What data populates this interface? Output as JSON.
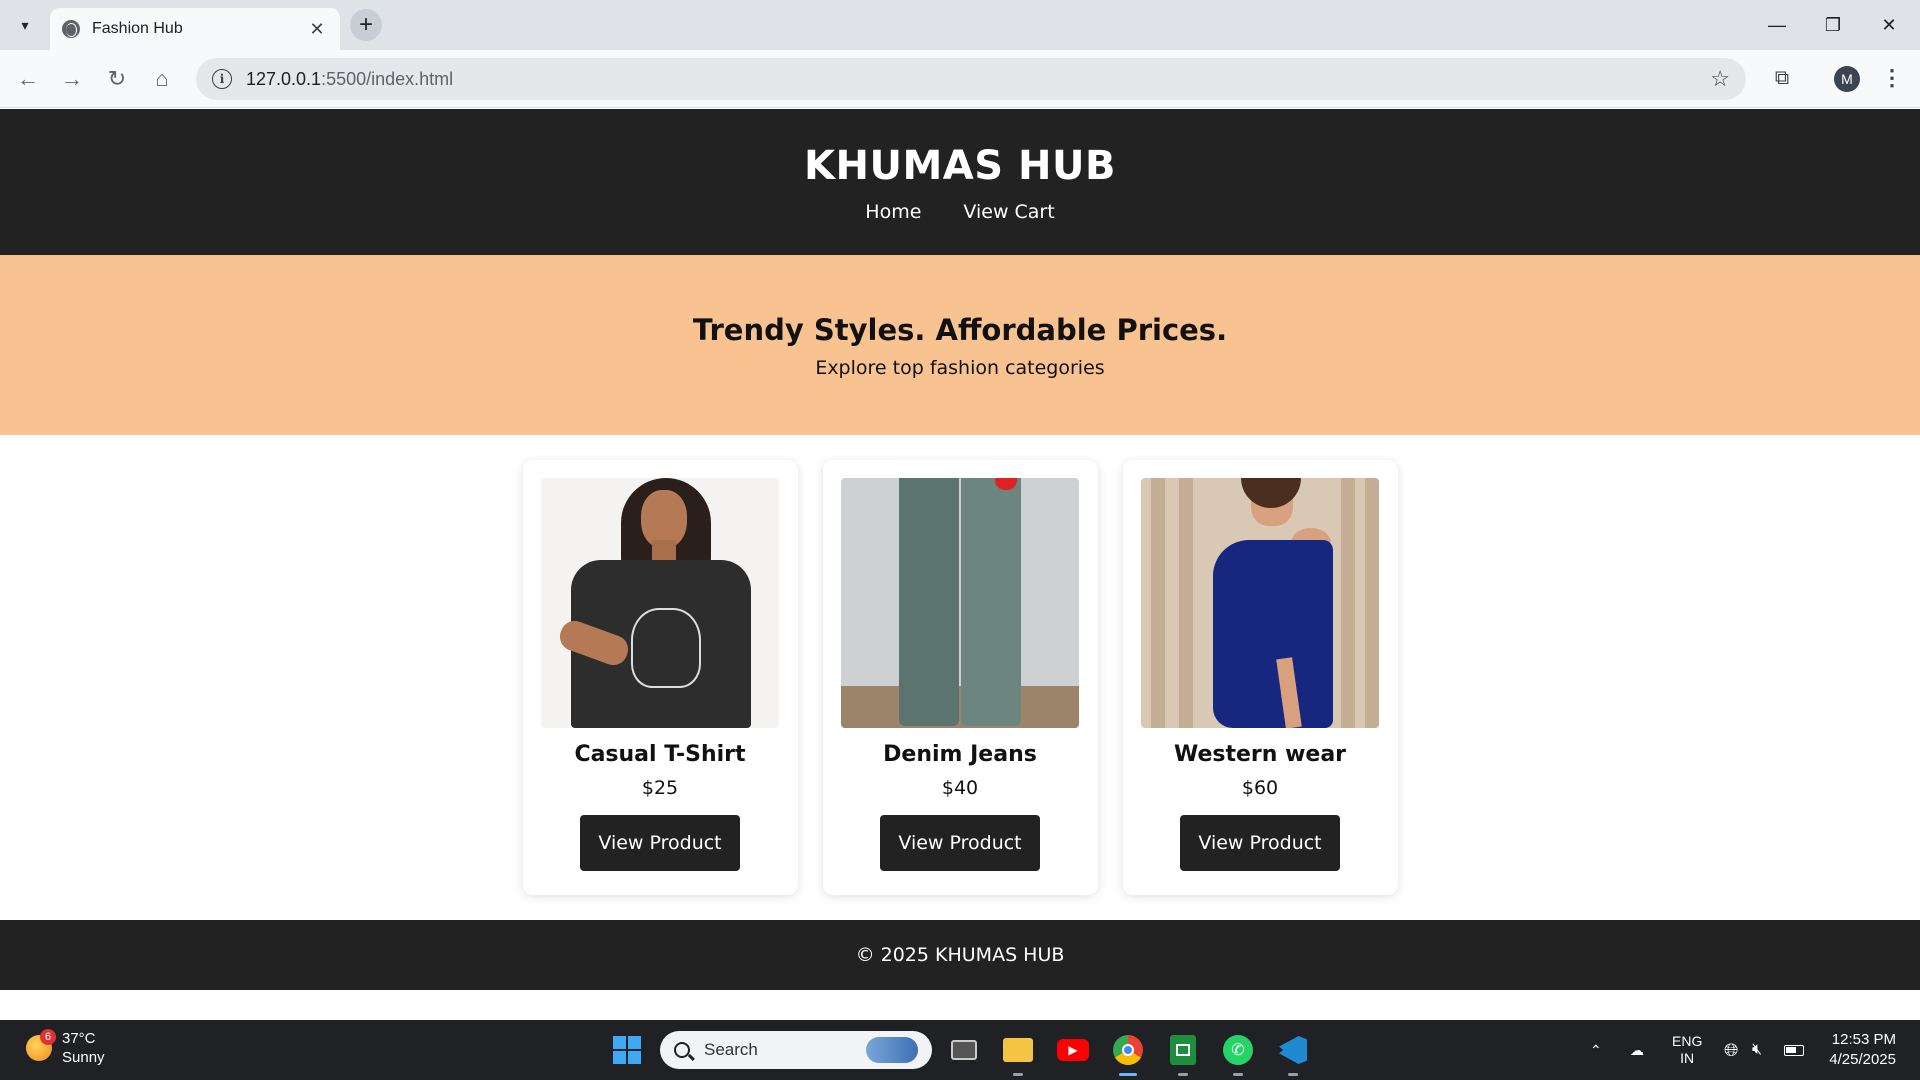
{
  "browser": {
    "tab_title": "Fashion Hub",
    "url_host": "127.0.0.1",
    "url_path": ":5500/index.html",
    "profile_initial": "M"
  },
  "site": {
    "title": "KHUMAS HUB",
    "nav": [
      "Home",
      "View Cart"
    ],
    "hero_title": "Trendy Styles. Affordable Prices.",
    "hero_subtitle": "Explore top fashion categories",
    "products": [
      {
        "name": "Casual T-Shirt",
        "price": "$25",
        "button": "View Product",
        "image_icon": "tshirt-photo"
      },
      {
        "name": "Denim Jeans",
        "price": "$40",
        "button": "View Product",
        "image_icon": "jeans-photo"
      },
      {
        "name": "Western wear",
        "price": "$60",
        "button": "View Product",
        "image_icon": "dress-photo"
      }
    ],
    "footer": "© 2025 KHUMAS HUB"
  },
  "taskbar": {
    "weather_temp": "37°C",
    "weather_desc": "Sunny",
    "weather_badge": "6",
    "search_placeholder": "Search",
    "lang_top": "ENG",
    "lang_bottom": "IN",
    "time": "12:53 PM",
    "date": "4/25/2025"
  },
  "colors": {
    "header_bg": "#222222",
    "hero_bg": "#f8c291",
    "button_bg": "#222222"
  }
}
